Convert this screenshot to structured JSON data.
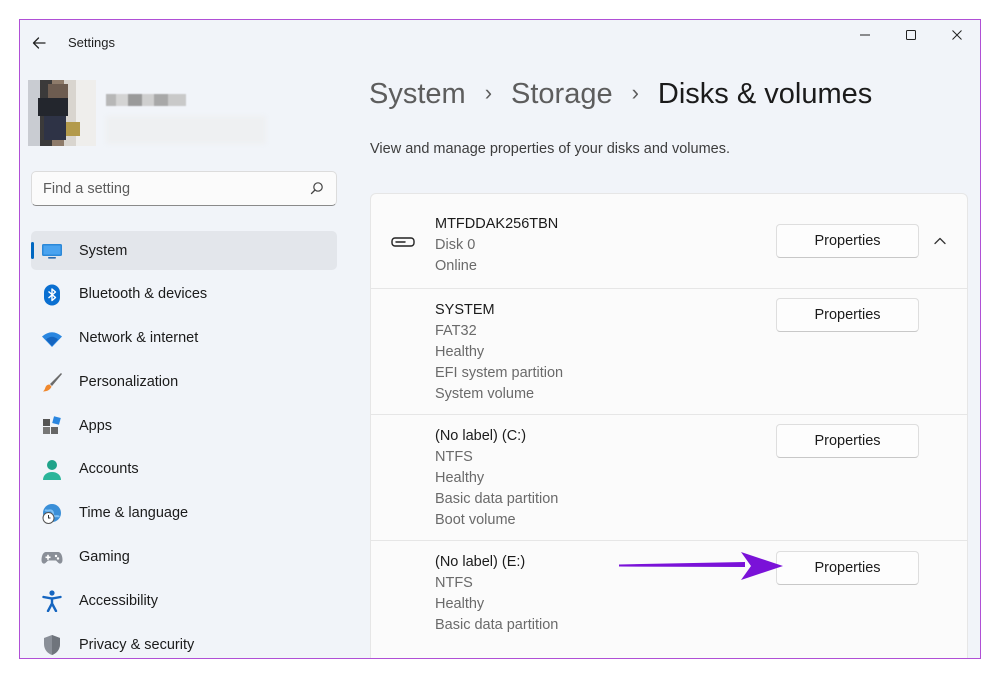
{
  "window": {
    "title": "Settings",
    "controls": {
      "minimize": "—",
      "maximize": "☐",
      "close": "✕"
    }
  },
  "sidebar": {
    "search": {
      "placeholder": "Find a setting"
    },
    "items": [
      {
        "label": "System",
        "icon": "monitor-icon",
        "selected": true
      },
      {
        "label": "Bluetooth & devices",
        "icon": "bluetooth-icon"
      },
      {
        "label": "Network & internet",
        "icon": "wifi-icon"
      },
      {
        "label": "Personalization",
        "icon": "brush-icon"
      },
      {
        "label": "Apps",
        "icon": "apps-icon"
      },
      {
        "label": "Accounts",
        "icon": "person-icon"
      },
      {
        "label": "Time & language",
        "icon": "globe-clock-icon"
      },
      {
        "label": "Gaming",
        "icon": "gamepad-icon"
      },
      {
        "label": "Accessibility",
        "icon": "accessibility-icon"
      },
      {
        "label": "Privacy & security",
        "icon": "shield-icon"
      }
    ]
  },
  "main": {
    "breadcrumb": [
      "System",
      "Storage",
      "Disks & volumes"
    ],
    "breadcrumb_separator": "›",
    "description": "View and manage properties of your disks and volumes.",
    "disk": {
      "name": "MTFDDAK256TBN",
      "lines": [
        "Disk 0",
        "Online"
      ],
      "button": "Properties",
      "expanded": true
    },
    "volumes": [
      {
        "name": "SYSTEM",
        "lines": [
          "FAT32",
          "Healthy",
          "EFI system partition",
          "System volume"
        ],
        "button": "Properties"
      },
      {
        "name": "(No label) (C:)",
        "lines": [
          "NTFS",
          "Healthy",
          "Basic data partition",
          "Boot volume"
        ],
        "button": "Properties"
      },
      {
        "name": "(No label) (E:)",
        "lines": [
          "NTFS",
          "Healthy",
          "Basic data partition"
        ],
        "button": "Properties"
      }
    ]
  },
  "colors": {
    "accent": "#0067c0",
    "annotation_arrow": "#7a12d8",
    "window_border": "#b04fd6"
  }
}
